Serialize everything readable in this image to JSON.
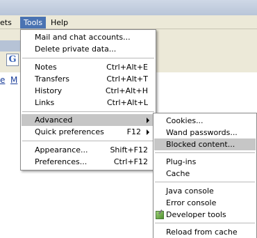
{
  "menubar": {
    "items": [
      {
        "label": "gets"
      },
      {
        "label": "Tools"
      },
      {
        "label": "Help"
      }
    ]
  },
  "page": {
    "links": [
      "e",
      "M"
    ]
  },
  "tools_menu": {
    "items": [
      {
        "label": "Mail and chat accounts..."
      },
      {
        "label": "Delete private data..."
      },
      {
        "label": "Notes",
        "shortcut": "Ctrl+Alt+E"
      },
      {
        "label": "Transfers",
        "shortcut": "Ctrl+Alt+T"
      },
      {
        "label": "History",
        "shortcut": "Ctrl+Alt+H"
      },
      {
        "label": "Links",
        "shortcut": "Ctrl+Alt+L"
      },
      {
        "label": "Advanced"
      },
      {
        "label": "Quick preferences",
        "shortcut": "F12"
      },
      {
        "label": "Appearance...",
        "shortcut": "Shift+F12"
      },
      {
        "label": "Preferences...",
        "shortcut": "Ctrl+F12"
      }
    ]
  },
  "advanced_submenu": {
    "items": [
      {
        "label": "Cookies..."
      },
      {
        "label": "Wand passwords..."
      },
      {
        "label": "Blocked content..."
      },
      {
        "label": "Plug-ins"
      },
      {
        "label": "Cache"
      },
      {
        "label": "Java console"
      },
      {
        "label": "Error console"
      },
      {
        "label": "Developer tools",
        "icon": "developer-tools-icon"
      },
      {
        "label": "Reload from cache"
      }
    ]
  },
  "colors": {
    "menubar_active": "#4a73b2",
    "menu_highlight": "#c6c6c6",
    "menu_background": "#ffffff",
    "chrome": "#ece9d8"
  }
}
